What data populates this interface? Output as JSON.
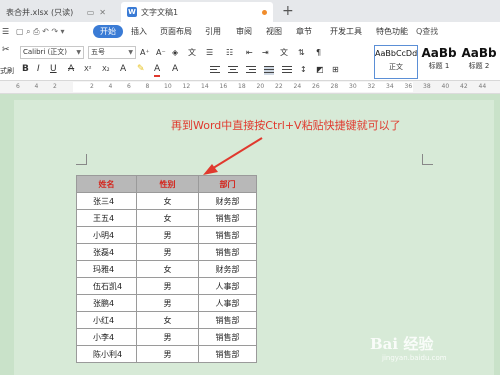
{
  "tabs": {
    "inactive_tab_label": "表合并.xlsx (只读)",
    "active_tab_label": "文字文稿1",
    "new_tab_symbol": "+"
  },
  "menu": {
    "items": [
      "开始",
      "插入",
      "页面布局",
      "引用",
      "审阅",
      "视图",
      "章节",
      "开发工具",
      "特色功能"
    ],
    "search_label": "Q查找"
  },
  "ribbon": {
    "font_name": "Calibri (正文)",
    "font_size": "五号",
    "left_cut_label": "式刷",
    "styles": [
      {
        "sample": "AaBbCcDd",
        "name": "正文"
      },
      {
        "sample": "AaBb",
        "name": "标题 1"
      },
      {
        "sample": "AaBb",
        "name": "标题 2"
      }
    ]
  },
  "ruler": {
    "ticks": [
      "6",
      "4",
      "2",
      "",
      "2",
      "4",
      "6",
      "8",
      "10",
      "12",
      "14",
      "16",
      "18",
      "20",
      "22",
      "24",
      "26",
      "28",
      "30",
      "32",
      "34",
      "36",
      "38",
      "40",
      "42",
      "44"
    ]
  },
  "annotation": {
    "text": "再到Word中直接按Ctrl+V粘贴快捷键就可以了",
    "color": "#e0392e"
  },
  "table": {
    "headers": [
      "姓名",
      "性别",
      "部门"
    ],
    "rows": [
      [
        "张三4",
        "女",
        "财务部"
      ],
      [
        "王五4",
        "女",
        "销售部"
      ],
      [
        "小明4",
        "男",
        "销售部"
      ],
      [
        "张磊4",
        "男",
        "销售部"
      ],
      [
        "玛雅4",
        "女",
        "财务部"
      ],
      [
        "伍石凯4",
        "男",
        "人事部"
      ],
      [
        "张鹏4",
        "男",
        "人事部"
      ],
      [
        "小红4",
        "女",
        "销售部"
      ],
      [
        "小李4",
        "男",
        "销售部"
      ],
      [
        "陈小利4",
        "男",
        "销售部"
      ]
    ]
  },
  "watermark": {
    "main": "Bai 经验",
    "sub": "jingyan.baidu.com"
  }
}
